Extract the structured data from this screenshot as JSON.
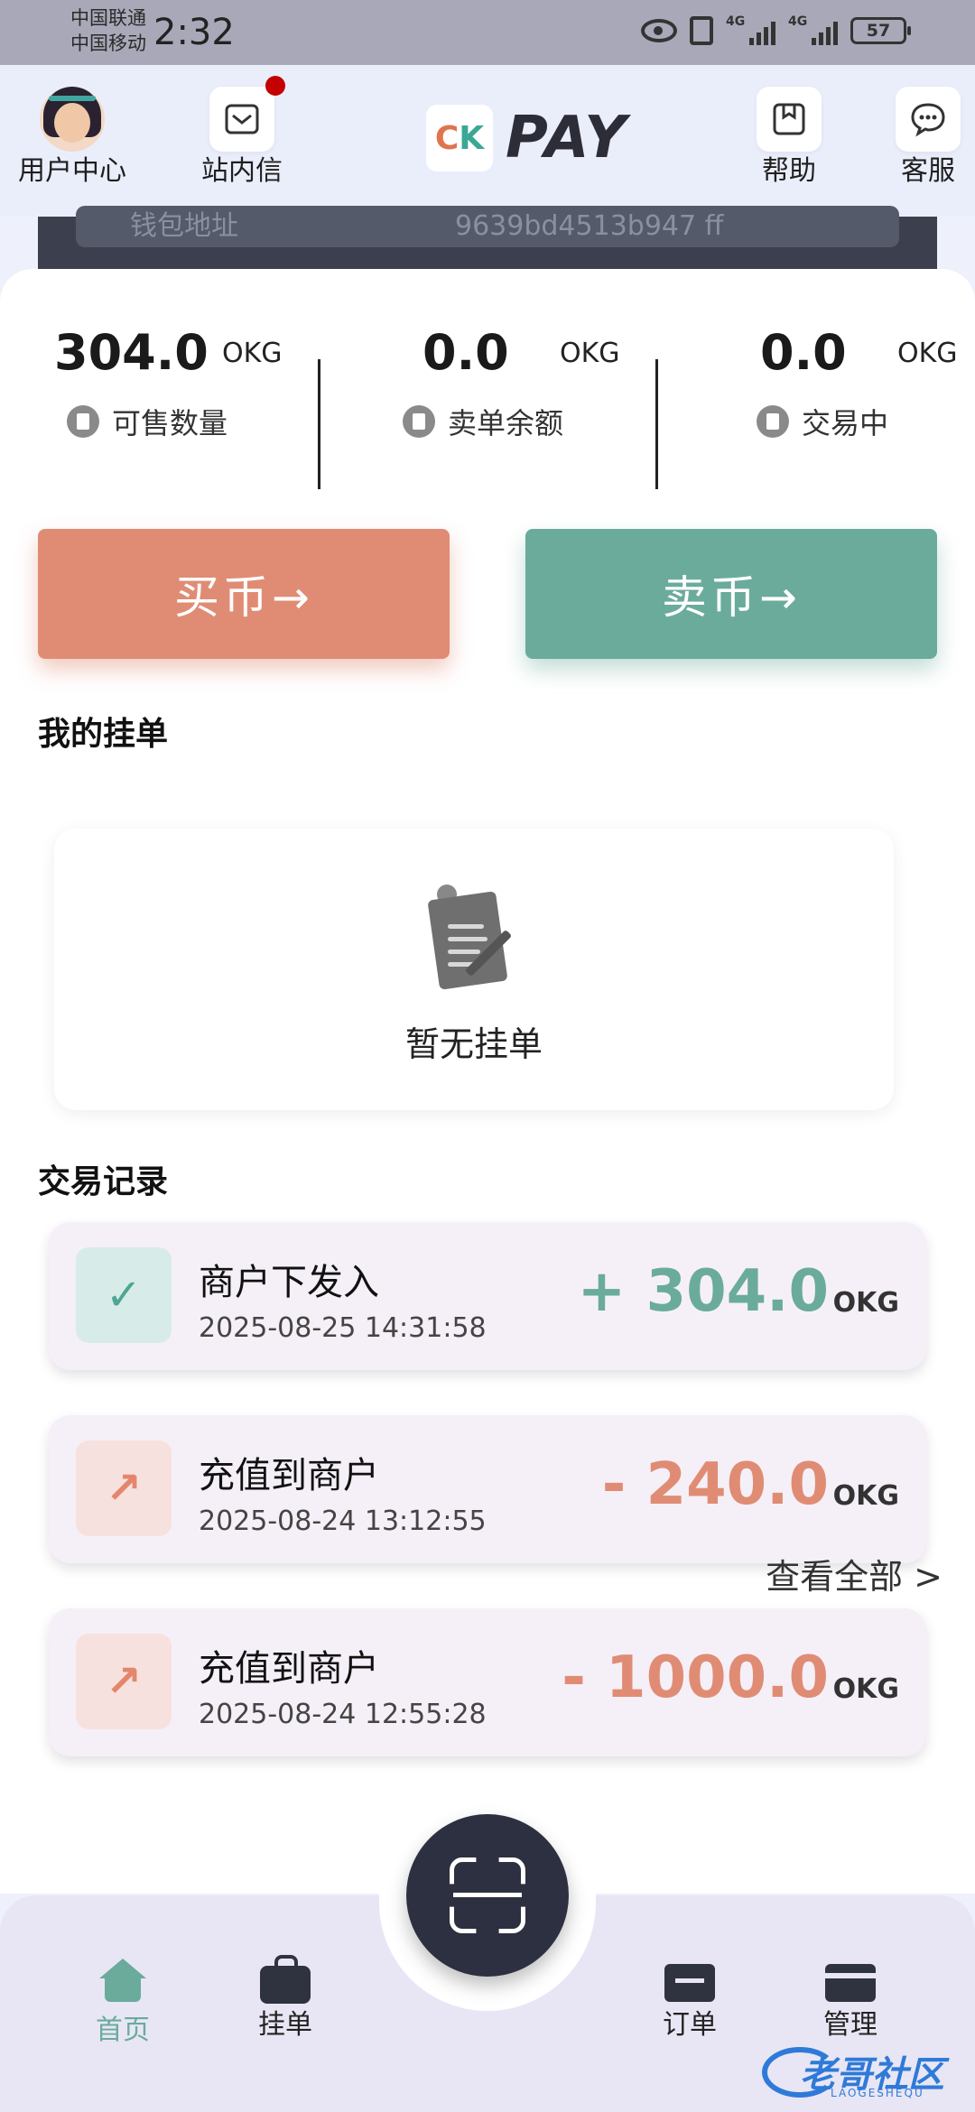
{
  "status_bar": {
    "carrier1": "中国联通",
    "carrier2": "中国移动",
    "time": "2:32",
    "signal_label_1": "4G",
    "signal_label_2": "4G",
    "battery": "57"
  },
  "header": {
    "user_center": "用户中心",
    "messages": "站内信",
    "logo_text": "PAY",
    "help": "帮助",
    "service": "客服"
  },
  "wallet": {
    "label": "钱包地址",
    "address": "9639bd4513b947 ff"
  },
  "stats": [
    {
      "value": "304.0",
      "unit": "OKG",
      "label": "可售数量"
    },
    {
      "value": "0.0",
      "unit": "OKG",
      "label": "卖单余额"
    },
    {
      "value": "0.0",
      "unit": "OKG",
      "label": "交易中"
    }
  ],
  "actions": {
    "buy": "买币→",
    "sell": "卖币→"
  },
  "my_orders": {
    "title": "我的挂单",
    "empty_text": "暂无挂单"
  },
  "records": {
    "title": "交易记录",
    "items": [
      {
        "title": "商户下发入",
        "time": "2025-08-25 14:31:58",
        "amount": "+ 304.0",
        "unit": "OKG",
        "icon": "check-icon"
      },
      {
        "title": "充值到商户",
        "time": "2025-08-24 13:12:55",
        "amount": "- 240.0",
        "unit": "OKG",
        "icon": "arrow-up-right-icon"
      },
      {
        "title": "充值到商户",
        "time": "2025-08-24 12:55:28",
        "amount": "- 1000.0",
        "unit": "OKG",
        "icon": "arrow-up-right-icon"
      }
    ],
    "view_all": "查看全部 >"
  },
  "bottom_nav": {
    "home": "首页",
    "orders_list": "挂单",
    "orders": "订单",
    "manage": "管理"
  },
  "watermark": {
    "text": "老哥社区",
    "sub": "LAOGESHEQU"
  },
  "colors": {
    "buy": "#e08c74",
    "sell": "#6aab9c",
    "positive": "#6aab9c",
    "negative": "#e08c74"
  }
}
